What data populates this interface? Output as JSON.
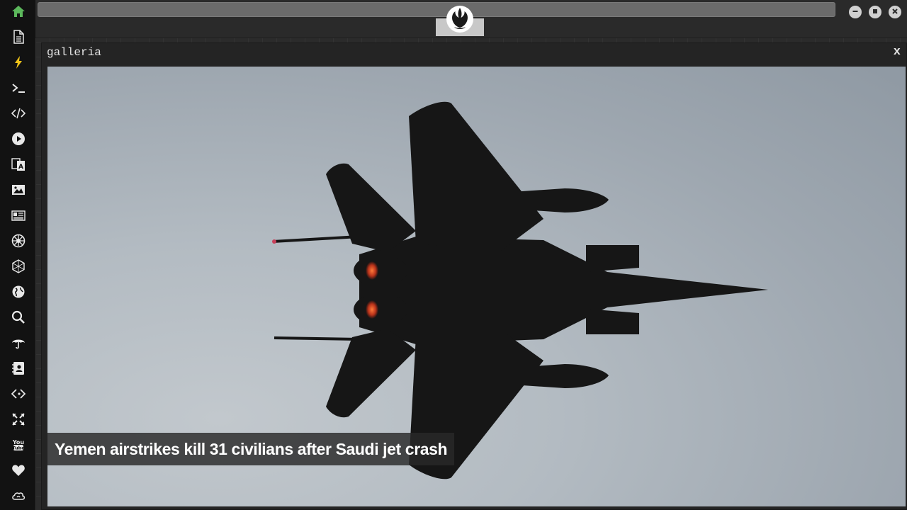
{
  "window": {
    "controls": [
      "minimize-icon",
      "maximize-icon",
      "close-icon"
    ]
  },
  "sidebar": {
    "items": [
      {
        "icon": "home-icon",
        "color": "#5cb85c",
        "active": true
      },
      {
        "icon": "document-icon"
      },
      {
        "icon": "lightning-icon",
        "color": "#f0c419"
      },
      {
        "icon": "terminal-icon"
      },
      {
        "icon": "code-icon"
      },
      {
        "icon": "play-icon"
      },
      {
        "icon": "translate-icon"
      },
      {
        "icon": "image-icon"
      },
      {
        "icon": "newspaper-icon"
      },
      {
        "icon": "empire-icon"
      },
      {
        "icon": "hexagon-icon"
      },
      {
        "icon": "globe-icon"
      },
      {
        "icon": "search-icon"
      },
      {
        "icon": "umbrella-icon"
      },
      {
        "icon": "contacts-icon"
      },
      {
        "icon": "code-fork-icon"
      },
      {
        "icon": "expand-icon"
      },
      {
        "icon": "youtube-icon"
      },
      {
        "icon": "heart-icon"
      },
      {
        "icon": "cloud-icon"
      }
    ]
  },
  "gallery": {
    "title": "galleria",
    "close_label": "x",
    "caption": "Yemen airstrikes kill 31 civilians after Saudi jet crash"
  },
  "colors": {
    "sidebar_bg": "#121212",
    "accent_green": "#5cb85c",
    "accent_yellow": "#f0c419"
  }
}
